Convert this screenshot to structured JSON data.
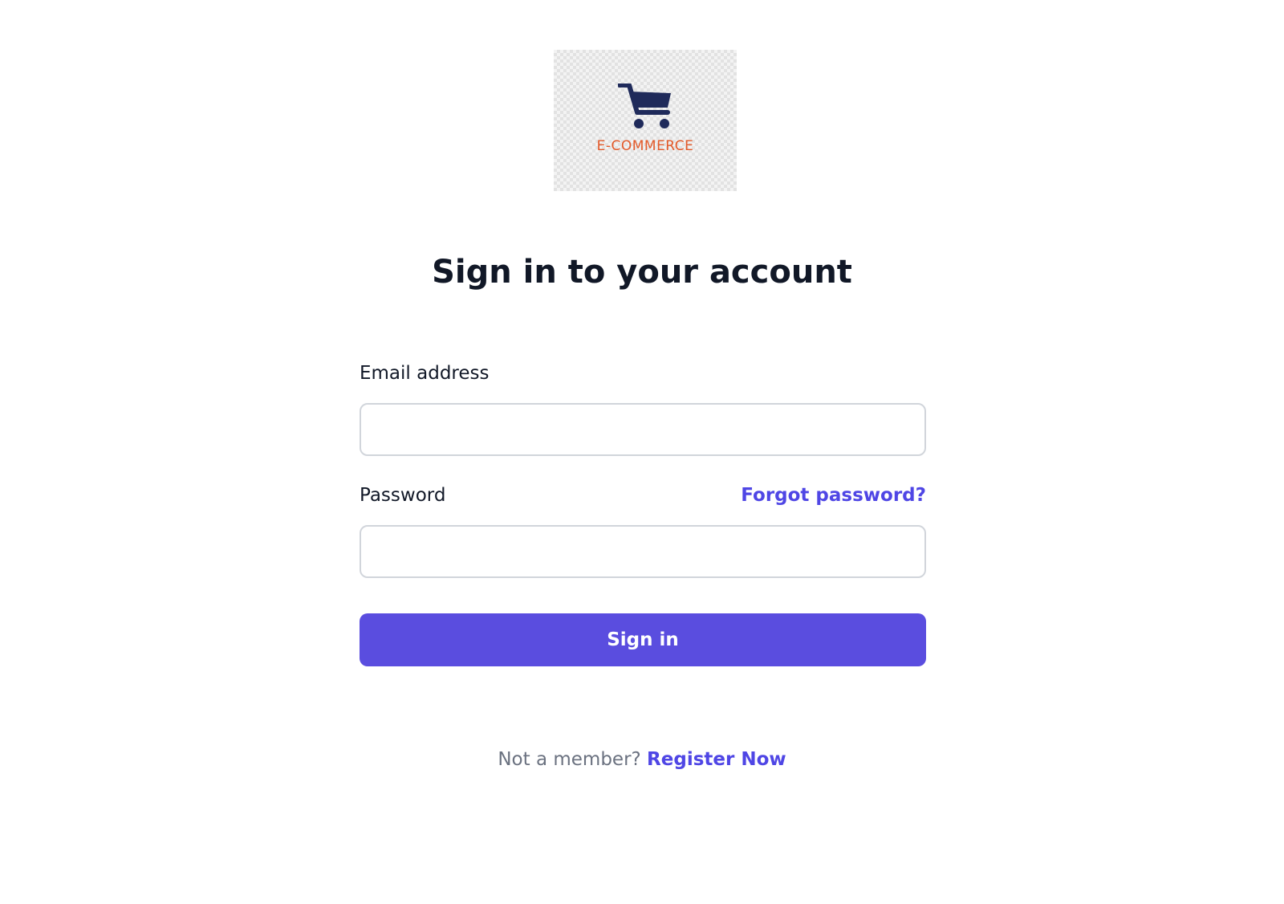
{
  "logo": {
    "text": "E-COMMERCE",
    "icon": "shopping-cart-icon",
    "cart_color": "#1f2a5a",
    "text_color": "#e35a2a"
  },
  "heading": "Sign in to your account",
  "form": {
    "email_label": "Email address",
    "email_value": "",
    "password_label": "Password",
    "password_value": "",
    "forgot_link": "Forgot password?",
    "submit_label": "Sign in"
  },
  "footer": {
    "prompt": "Not a member?",
    "register_link": "Register Now"
  },
  "colors": {
    "primary": "#5a4ddf",
    "link": "#4f46e5",
    "heading": "#111827",
    "muted": "#6b7280"
  }
}
